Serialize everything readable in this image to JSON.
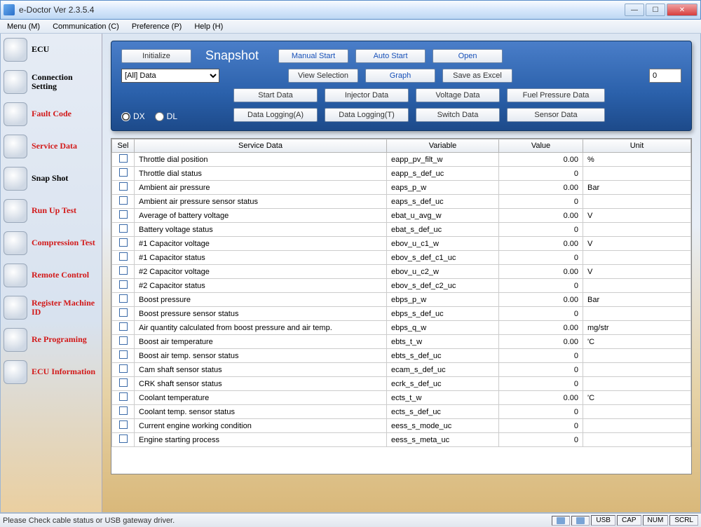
{
  "window": {
    "title": "e-Doctor Ver 2.3.5.4"
  },
  "menu": {
    "items": [
      "Menu (M)",
      "Communication (C)",
      "Preference (P)",
      "Help (H)"
    ]
  },
  "sidebar": {
    "items": [
      {
        "label": "ECU",
        "red": false
      },
      {
        "label": "Connection Setting",
        "red": false
      },
      {
        "label": "Fault Code",
        "red": true
      },
      {
        "label": "Service Data",
        "red": true
      },
      {
        "label": "Snap Shot",
        "red": false
      },
      {
        "label": "Run Up Test",
        "red": true
      },
      {
        "label": "Compression Test",
        "red": true
      },
      {
        "label": "Remote Control",
        "red": true
      },
      {
        "label": "Register Machine ID",
        "red": true
      },
      {
        "label": "Re Programing",
        "red": true
      },
      {
        "label": "ECU Information",
        "red": true
      }
    ]
  },
  "panel": {
    "initialize": "Initialize",
    "title": "Snapshot",
    "manual_start": "Manual Start",
    "auto_start": "Auto Start",
    "open": "Open",
    "combo_value": "[All] Data",
    "view_selection": "View Selection",
    "graph": "Graph",
    "save_excel": "Save as Excel",
    "spin_value": "0",
    "start_data": "Start Data",
    "injector_data": "Injector Data",
    "voltage_data": "Voltage Data",
    "fuel_pressure": "Fuel Pressure Data",
    "data_log_a": "Data Logging(A)",
    "data_log_t": "Data Logging(T)",
    "switch_data": "Switch Data",
    "sensor_data": "Sensor Data",
    "radio_dx": "DX",
    "radio_dl": "DL"
  },
  "table": {
    "headers": {
      "sel": "Sel",
      "service": "Service Data",
      "variable": "Variable",
      "value": "Value",
      "unit": "Unit"
    },
    "rows": [
      {
        "service": "Throttle dial position",
        "variable": "eapp_pv_filt_w",
        "value": "0.00",
        "unit": "%"
      },
      {
        "service": "Throttle dial status",
        "variable": "eapp_s_def_uc",
        "value": "0",
        "unit": ""
      },
      {
        "service": "Ambient air pressure",
        "variable": "eaps_p_w",
        "value": "0.00",
        "unit": "Bar"
      },
      {
        "service": "Ambient air pressure sensor status",
        "variable": "eaps_s_def_uc",
        "value": "0",
        "unit": ""
      },
      {
        "service": "Average of battery voltage",
        "variable": "ebat_u_avg_w",
        "value": "0.00",
        "unit": "V"
      },
      {
        "service": "Battery voltage status",
        "variable": "ebat_s_def_uc",
        "value": "0",
        "unit": ""
      },
      {
        "service": "#1 Capacitor voltage",
        "variable": "ebov_u_c1_w",
        "value": "0.00",
        "unit": "V"
      },
      {
        "service": "#1 Capacitor status",
        "variable": "ebov_s_def_c1_uc",
        "value": "0",
        "unit": ""
      },
      {
        "service": "#2 Capacitor voltage",
        "variable": "ebov_u_c2_w",
        "value": "0.00",
        "unit": "V"
      },
      {
        "service": "#2 Capacitor status",
        "variable": "ebov_s_def_c2_uc",
        "value": "0",
        "unit": ""
      },
      {
        "service": "Boost pressure",
        "variable": "ebps_p_w",
        "value": "0.00",
        "unit": "Bar"
      },
      {
        "service": "Boost pressure sensor status",
        "variable": "ebps_s_def_uc",
        "value": "0",
        "unit": ""
      },
      {
        "service": "Air quantity calculated from boost pressure and air temp.",
        "variable": "ebps_q_w",
        "value": "0.00",
        "unit": "mg/str"
      },
      {
        "service": "Boost air temperature",
        "variable": "ebts_t_w",
        "value": "0.00",
        "unit": "'C"
      },
      {
        "service": "Boost air temp. sensor status",
        "variable": "ebts_s_def_uc",
        "value": "0",
        "unit": ""
      },
      {
        "service": "Cam shaft sensor status",
        "variable": "ecam_s_def_uc",
        "value": "0",
        "unit": ""
      },
      {
        "service": "CRK shaft sensor status",
        "variable": "ecrk_s_def_uc",
        "value": "0",
        "unit": ""
      },
      {
        "service": "Coolant temperature",
        "variable": "ects_t_w",
        "value": "0.00",
        "unit": "'C"
      },
      {
        "service": "Coolant temp. sensor status",
        "variable": "ects_s_def_uc",
        "value": "0",
        "unit": ""
      },
      {
        "service": "Current engine working condition",
        "variable": "eess_s_mode_uc",
        "value": "0",
        "unit": ""
      },
      {
        "service": "Engine starting process",
        "variable": "eess_s_meta_uc",
        "value": "0",
        "unit": ""
      }
    ]
  },
  "status": {
    "message": "Please Check cable status or USB gateway driver.",
    "usb": "USB",
    "cap": "CAP",
    "num": "NUM",
    "scrl": "SCRL"
  }
}
